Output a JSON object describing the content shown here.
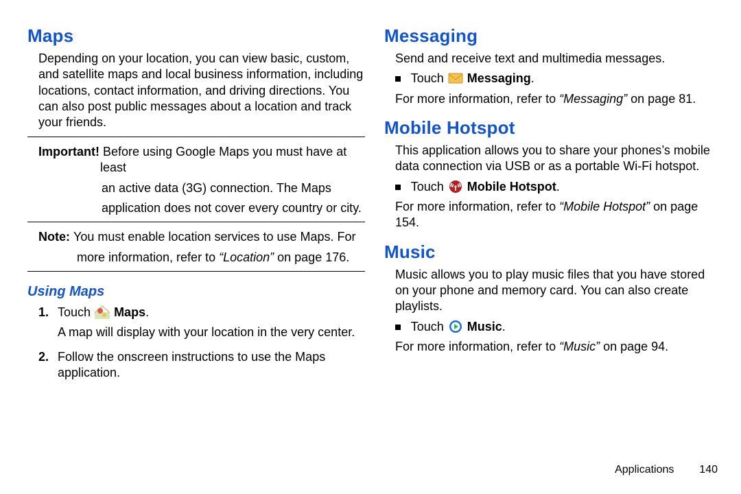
{
  "left": {
    "maps_h": "Maps",
    "maps_p1": "Depending on your location, you can view basic, custom, and satellite maps and local business information, including locations, contact information, and driving directions. You can also post public messages about a location and track your friends.",
    "important_label": "Important! ",
    "important_text1": "Before using Google Maps you must have at least",
    "important_text2": "an active data (3G) connection. The Maps",
    "important_text3": "application does not cover every country or city.",
    "note_label": "Note: ",
    "note_text1": "You must enable location services to use Maps. For",
    "note_text2": "more information, refer to ",
    "note_ref": "“Location” ",
    "note_text3": "on page 176.",
    "using_h": "Using Maps",
    "step1_num": "1.",
    "step1a": "Touch ",
    "step1b_bold": " Maps",
    "step1c": ".",
    "step1_desc": "A map will display with your location in the very center.",
    "step2_num": "2.",
    "step2_text": "Follow the onscreen instructions to use the Maps application."
  },
  "right": {
    "msg_h": "Messaging",
    "msg_p1": "Send and receive text and multimedia messages.",
    "msg_touch": "Touch ",
    "msg_bold": " Messaging",
    "msg_dot": ".",
    "msg_ref_pre": "For more information, refer to ",
    "msg_ref_it": "“Messaging” ",
    "msg_ref_post": "on page 81.",
    "hot_h": "Mobile Hotspot",
    "hot_p1": "This application allows you to share your phones’s mobile data connection via USB or as a portable Wi-Fi hotspot.",
    "hot_touch": "Touch ",
    "hot_bold": " Mobile Hotspot",
    "hot_dot": ".",
    "hot_ref_pre": "For more information, refer to ",
    "hot_ref_it": "“Mobile Hotspot” ",
    "hot_ref_post": "on page 154.",
    "mus_h": "Music",
    "mus_p1": "Music allows you to play music files that you have stored on your phone and memory card. You can also create playlists.",
    "mus_touch": "Touch ",
    "mus_bold": " Music",
    "mus_dot": ".",
    "mus_ref_pre": "For more information, refer to ",
    "mus_ref_it": "“Music” ",
    "mus_ref_post": "on page 94."
  },
  "footer": {
    "section": "Applications",
    "page": "140"
  }
}
